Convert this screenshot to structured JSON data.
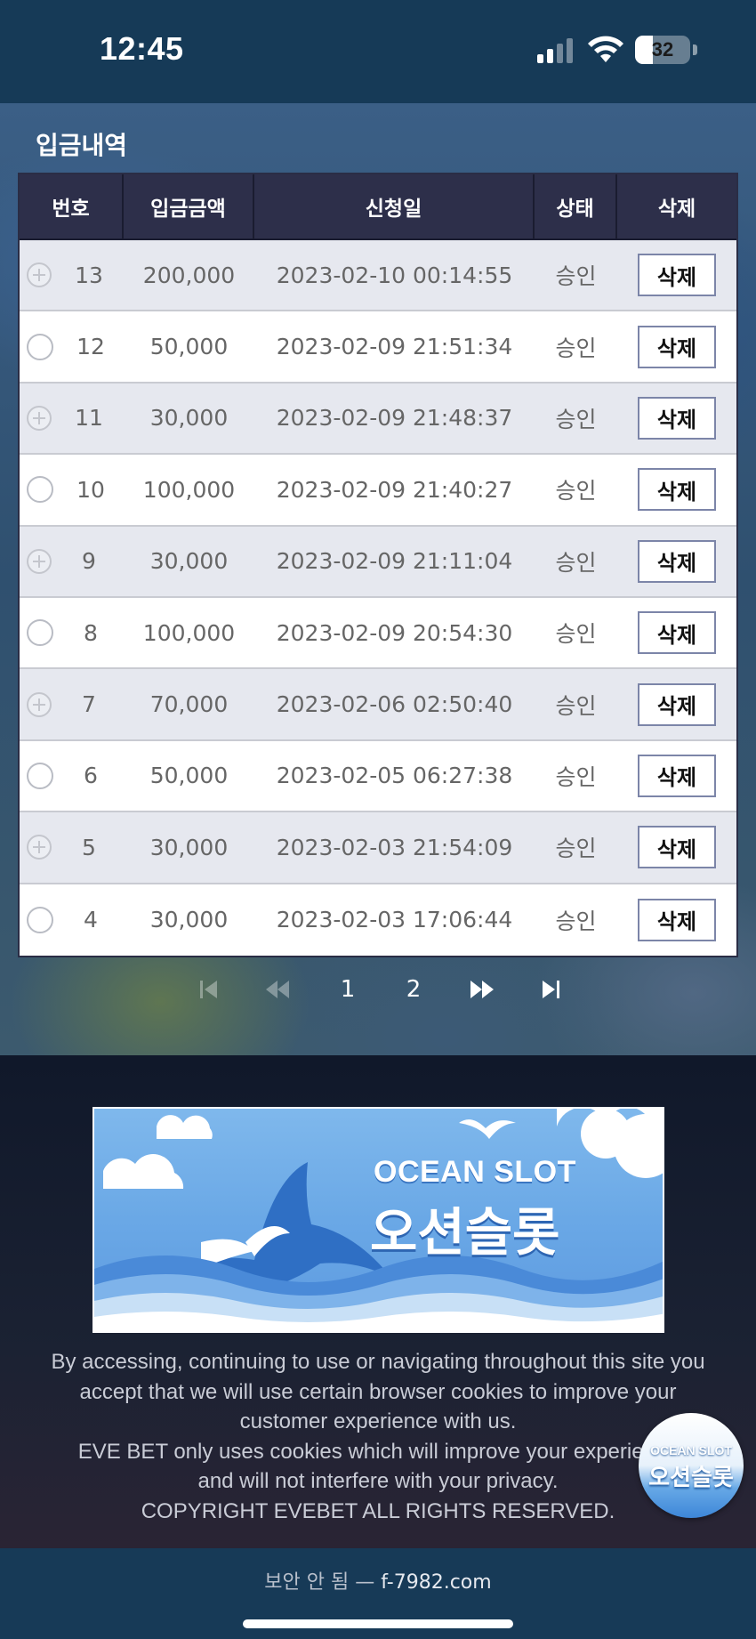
{
  "status_bar": {
    "time": "12:45",
    "battery": "32",
    "battery_level": 0.32
  },
  "page_title": "입금내역",
  "table": {
    "headers": [
      "번호",
      "입금금액",
      "신청일",
      "상태",
      "삭제"
    ],
    "rows": [
      {
        "no": "13",
        "amount": "200,000",
        "date": "2023-02-10 00:14:55",
        "status": "승인",
        "delete": "삭제",
        "icon": "plus-circle-icon"
      },
      {
        "no": "12",
        "amount": "50,000",
        "date": "2023-02-09 21:51:34",
        "status": "승인",
        "delete": "삭제",
        "icon": "radio-icon"
      },
      {
        "no": "11",
        "amount": "30,000",
        "date": "2023-02-09 21:48:37",
        "status": "승인",
        "delete": "삭제",
        "icon": "plus-circle-icon"
      },
      {
        "no": "10",
        "amount": "100,000",
        "date": "2023-02-09 21:40:27",
        "status": "승인",
        "delete": "삭제",
        "icon": "radio-icon"
      },
      {
        "no": "9",
        "amount": "30,000",
        "date": "2023-02-09 21:11:04",
        "status": "승인",
        "delete": "삭제",
        "icon": "plus-circle-icon"
      },
      {
        "no": "8",
        "amount": "100,000",
        "date": "2023-02-09 20:54:30",
        "status": "승인",
        "delete": "삭제",
        "icon": "radio-icon"
      },
      {
        "no": "7",
        "amount": "70,000",
        "date": "2023-02-06 02:50:40",
        "status": "승인",
        "delete": "삭제",
        "icon": "plus-circle-icon"
      },
      {
        "no": "6",
        "amount": "50,000",
        "date": "2023-02-05 06:27:38",
        "status": "승인",
        "delete": "삭제",
        "icon": "radio-icon"
      },
      {
        "no": "5",
        "amount": "30,000",
        "date": "2023-02-03 21:54:09",
        "status": "승인",
        "delete": "삭제",
        "icon": "plus-circle-icon"
      },
      {
        "no": "4",
        "amount": "30,000",
        "date": "2023-02-03 17:06:44",
        "status": "승인",
        "delete": "삭제",
        "icon": "radio-icon"
      }
    ]
  },
  "pagination": {
    "first_icon": "skip-to-first-icon",
    "prev_icon": "rewind-icon",
    "pages": [
      "1",
      "2"
    ],
    "next_icon": "fast-forward-icon",
    "last_icon": "skip-to-last-icon"
  },
  "banner": {
    "title_en": "OCEAN SLOT",
    "title_ko": "오션슬롯"
  },
  "footer": {
    "lines": [
      "By accessing, continuing to use or navigating throughout this site you",
      "accept that we will use certain browser cookies to improve your",
      "customer experience with us.",
      "EVE BET only uses cookies which will improve your experience",
      "and will not interfere with your privacy.",
      "COPYRIGHT EVEBET ALL RIGHTS RESERVED."
    ]
  },
  "floating_badge": {
    "title_en": "OCEAN SLOT",
    "title_ko": "오션슬롯"
  },
  "url_bar": {
    "warning": "보안 안 됨 —",
    "domain": "f-7982.com"
  },
  "colors": {
    "header_bg": "#2d2f4a",
    "status_bar_bg": "#163a57",
    "row_shade": "#e6e8ef",
    "delete_border": "#7c85a8"
  }
}
